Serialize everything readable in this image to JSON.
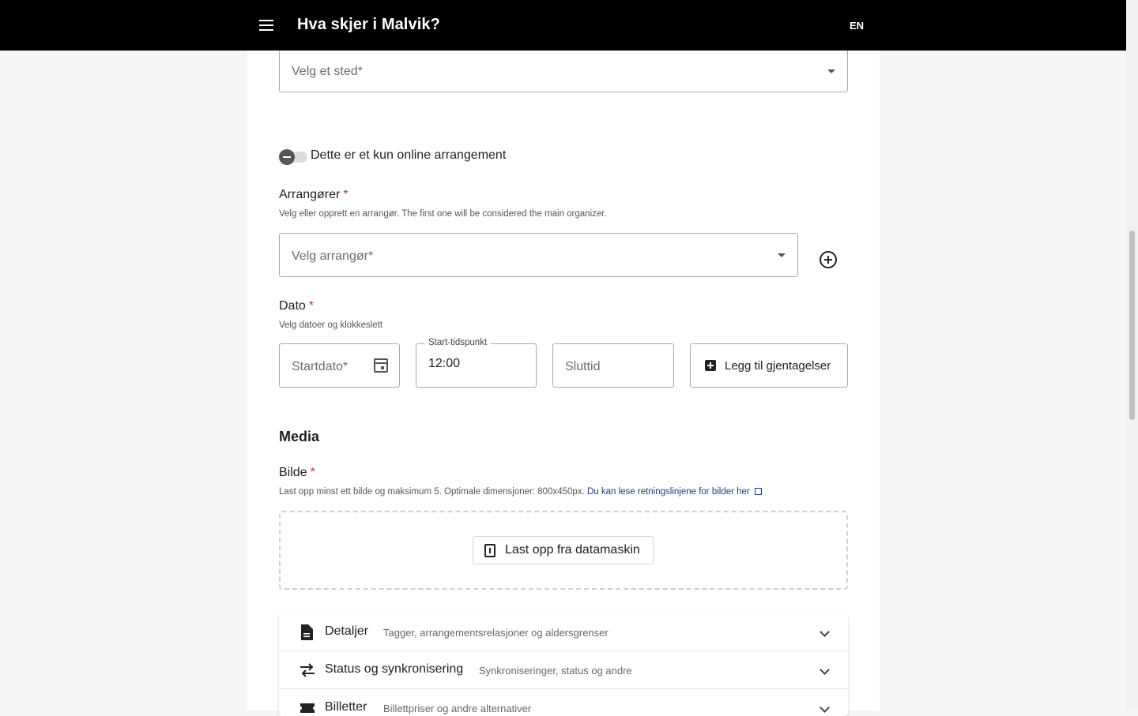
{
  "header": {
    "title": "Hva skjer i Malvik?",
    "language": "EN"
  },
  "location": {
    "placeholder": "Velg et sted*"
  },
  "online_toggle": {
    "label": "Dette er et kun online arrangement"
  },
  "organizers": {
    "label": "Arrangører",
    "required_mark": "*",
    "help": "Velg eller opprett en arrangør. The first one will be considered the main organizer.",
    "placeholder": "Velg arrangør*"
  },
  "date": {
    "label": "Dato",
    "required_mark": "*",
    "help": "Velg datoer og klokkeslett",
    "start_date_placeholder": "Startdato*",
    "start_time_label": "Start-tidspunkt",
    "start_time_value": "12:00",
    "end_time_placeholder": "Sluttid",
    "repeat_button": "Legg til gjentagelser"
  },
  "media": {
    "heading": "Media",
    "image_label": "Bilde",
    "required_mark": "*",
    "help": "Last opp minst ett bilde og maksimum 5. Optimale dimensjoner: 800x450px.",
    "guidelines_link": "Du kan lese retningslinjene for bilder her",
    "upload_button": "Last opp fra datamaskin"
  },
  "accordion": [
    {
      "title": "Detaljer",
      "description": "Tagger, arrangementsrelasjoner og aldersgrenser",
      "icon": "document-icon"
    },
    {
      "title": "Status og synkronisering",
      "description": "Synkroniseringer, status og andre",
      "icon": "sync-arrows-icon"
    },
    {
      "title": "Billetter",
      "description": "Billettpriser og andre alternativer",
      "icon": "ticket-icon"
    }
  ]
}
